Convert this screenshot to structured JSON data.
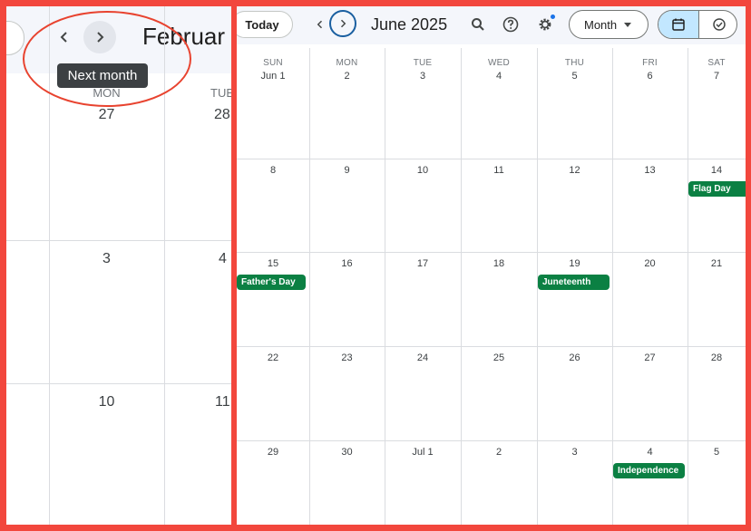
{
  "left_panel": {
    "month_title": "Februar",
    "tooltip": "Next month",
    "dow": [
      "MON",
      "TUE"
    ],
    "rows": [
      [
        "27",
        "28"
      ],
      [
        "3",
        "4"
      ],
      [
        "10",
        "11"
      ]
    ]
  },
  "right_panel": {
    "today_label": "Today",
    "month_title": "June 2025",
    "view_label": "Month",
    "dow": [
      "SUN",
      "MON",
      "TUE",
      "WED",
      "THU",
      "FRI",
      "SAT"
    ],
    "weeks": [
      [
        "Jun 1",
        "2",
        "3",
        "4",
        "5",
        "6",
        "7"
      ],
      [
        "8",
        "9",
        "10",
        "11",
        "12",
        "13",
        "14"
      ],
      [
        "15",
        "16",
        "17",
        "18",
        "19",
        "20",
        "21"
      ],
      [
        "22",
        "23",
        "24",
        "25",
        "26",
        "27",
        "28"
      ],
      [
        "29",
        "30",
        "Jul 1",
        "2",
        "3",
        "4",
        "5"
      ]
    ],
    "events": [
      {
        "label": "Flag Day",
        "week": 1,
        "day": 6
      },
      {
        "label": "Father's Day",
        "week": 2,
        "day": 0
      },
      {
        "label": "Juneteenth",
        "week": 2,
        "day": 4
      },
      {
        "label": "Independence",
        "week": 4,
        "day": 5
      }
    ]
  },
  "colors": {
    "frame": "#f2473d",
    "annotation_ring": "#e8432f",
    "event": "#0b8043",
    "accent": "#1a73e8"
  }
}
